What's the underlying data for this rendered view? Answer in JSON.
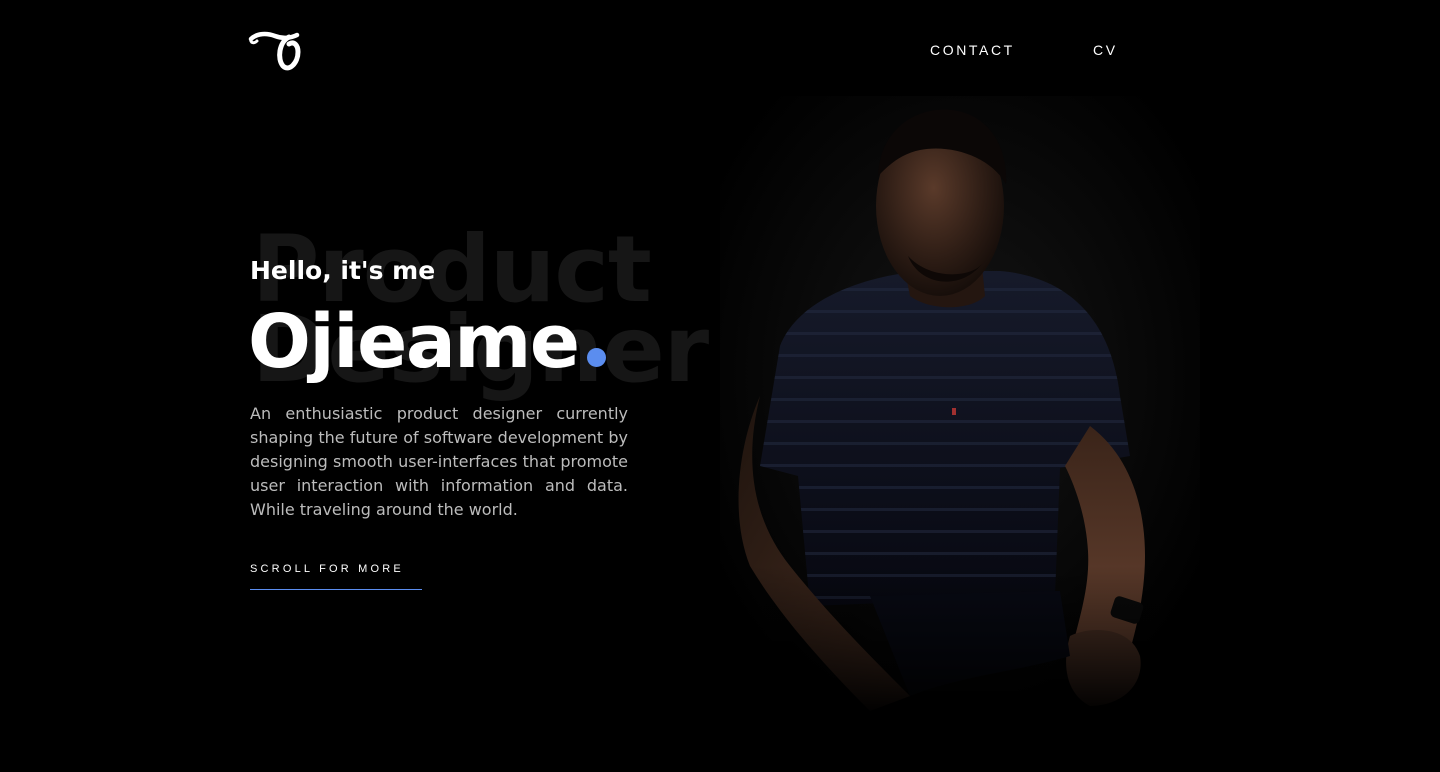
{
  "header": {
    "logo_icon": "script-letter-o-logo",
    "nav": [
      {
        "label": "CONTACT"
      },
      {
        "label": "CV"
      }
    ]
  },
  "hero": {
    "background_words": [
      "Product",
      "Designer"
    ],
    "greeting": "Hello, it's me",
    "name": "Ojieame",
    "bio": "An enthusiastic product designer currently shaping the future of software development by designing smooth user-interfaces that promote user interaction with information and data. While traveling around the world.",
    "cta_label": "SCROLL FOR MORE"
  },
  "colors": {
    "background": "#000000",
    "text": "#ffffff",
    "muted_text": "#bcbcbc",
    "ghost_text": "#161616",
    "accent": "#5b8def"
  }
}
